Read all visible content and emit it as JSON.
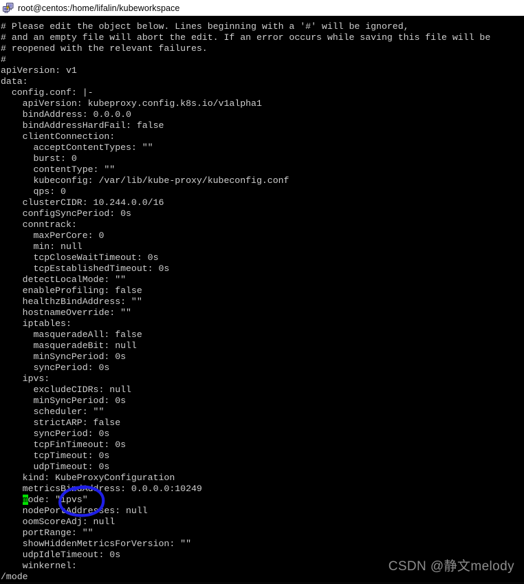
{
  "window": {
    "title": "root@centos:/home/lifalin/kubeworkspace",
    "icon": "putty-terminal-icon",
    "titlebar_bg": "#ffffff",
    "titlebar_fg": "#000000"
  },
  "terminal": {
    "background": "#000000",
    "foreground": "#cfcfcf",
    "cursor_color": "#00e000",
    "cursor_text_color": "#000000",
    "lines": [
      "# Please edit the object below. Lines beginning with a '#' will be ignored,",
      "# and an empty file will abort the edit. If an error occurs while saving this file will be",
      "# reopened with the relevant failures.",
      "#",
      "apiVersion: v1",
      "data:",
      "  config.conf: |-",
      "    apiVersion: kubeproxy.config.k8s.io/v1alpha1",
      "    bindAddress: 0.0.0.0",
      "    bindAddressHardFail: false",
      "    clientConnection:",
      "      acceptContentTypes: \"\"",
      "      burst: 0",
      "      contentType: \"\"",
      "      kubeconfig: /var/lib/kube-proxy/kubeconfig.conf",
      "      qps: 0",
      "    clusterCIDR: 10.244.0.0/16",
      "    configSyncPeriod: 0s",
      "    conntrack:",
      "      maxPerCore: 0",
      "      min: null",
      "      tcpCloseWaitTimeout: 0s",
      "      tcpEstablishedTimeout: 0s",
      "    detectLocalMode: \"\"",
      "    enableProfiling: false",
      "    healthzBindAddress: \"\"",
      "    hostnameOverride: \"\"",
      "    iptables:",
      "      masqueradeAll: false",
      "      masqueradeBit: null",
      "      minSyncPeriod: 0s",
      "      syncPeriod: 0s",
      "    ipvs:",
      "      excludeCIDRs: null",
      "      minSyncPeriod: 0s",
      "      scheduler: \"\"",
      "      strictARP: false",
      "      syncPeriod: 0s",
      "      tcpFinTimeout: 0s",
      "      tcpTimeout: 0s",
      "      udpTimeout: 0s",
      "    kind: KubeProxyConfiguration",
      "    metricsBindAddress: 0.0.0.0:10249",
      "    mode: \"ipvs\"",
      "    nodePortAddresses: null",
      "    oomScoreAdj: null",
      "    portRange: \"\"",
      "    showHiddenMetricsForVersion: \"\"",
      "    udpIdleTimeout: 0s",
      "    winkernel:"
    ],
    "cursor": {
      "line_index": 43,
      "column": 4,
      "char": "m"
    },
    "command_line": "/mode"
  },
  "annotation": {
    "type": "hand-drawn-ellipse",
    "color": "#1f1fe6",
    "target_text": "\"ipvs\""
  },
  "watermark": {
    "text": "CSDN @静文melody",
    "color": "#8d8d8d"
  }
}
